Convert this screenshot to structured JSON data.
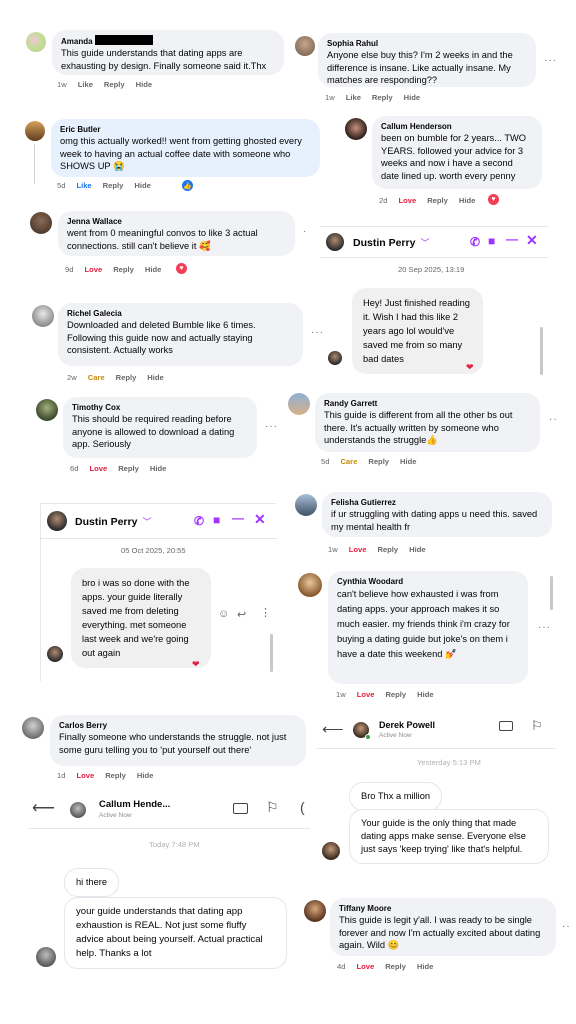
{
  "comments": {
    "amanda": {
      "name": "Amanda",
      "text": "This guide understands that dating apps are exhausting by design. Finally someone said it.Thx",
      "time": "1w",
      "like": "Like",
      "reply": "Reply",
      "hide": "Hide"
    },
    "sophia": {
      "name": "Sophia Rahul",
      "text": "Anyone else buy this? I'm 2 weeks in and the difference is insane. Like actually insane. My matches are responding??",
      "time": "1w",
      "like": "Like",
      "reply": "Reply",
      "hide": "Hide"
    },
    "eric": {
      "name": "Eric Butler",
      "text": "omg this actually worked!! went from getting ghosted every week to having an actual coffee date with someone who SHOWS UP 😭",
      "time": "5d",
      "like": "Like",
      "reply": "Reply",
      "hide": "Hide"
    },
    "callum": {
      "name": "Callum Henderson",
      "text": "been on bumble for 2 years... TWO YEARS. followed your advice for 3 weeks and now i have a second date lined up. worth every penny",
      "time": "2d",
      "love": "Love",
      "reply": "Reply",
      "hide": "Hide"
    },
    "jenna": {
      "name": "Jenna Wallace",
      "text": "went from 0 meaningful convos to like 3 actual connections. still can't believe it 🥰",
      "time": "9d",
      "love": "Love",
      "reply": "Reply",
      "hide": "Hide"
    },
    "richel": {
      "name": "Richel Galecia",
      "text": "Downloaded and deleted Bumble like 6 times. Following this guide now and actually staying consistent. Actually works",
      "time": "2w",
      "care": "Care",
      "reply": "Reply",
      "hide": "Hide"
    },
    "timothy": {
      "name": "Timothy Cox",
      "text": "This should be required reading before anyone is allowed to download a dating app. Seriously",
      "time": "6d",
      "love": "Love",
      "reply": "Reply",
      "hide": "Hide"
    },
    "randy": {
      "name": "Randy Garrett",
      "text": "This guide is different from all the other bs out there. It's actually written by someone who understands the struggle👍",
      "time": "5d",
      "care": "Care",
      "reply": "Reply",
      "hide": "Hide"
    },
    "felisha": {
      "name": "Felisha Gutierrez",
      "text": "if ur struggling with dating apps u need this. saved my mental health fr",
      "time": "1w",
      "love": "Love",
      "reply": "Reply",
      "hide": "Hide"
    },
    "cynthia": {
      "name": "Cynthia Woodard",
      "text": "can't believe how exhausted i was from dating apps. your approach makes it so much easier. my friends think i'm crazy for buying a dating guide but joke's on them i have a date this weekend 💅",
      "time": "1w",
      "love": "Love",
      "reply": "Reply",
      "hide": "Hide"
    },
    "carlos": {
      "name": "Carlos Berry",
      "text": "Finally someone who understands the struggle. not just some guru telling you to 'put yourself out there'",
      "time": "1d",
      "love": "Love",
      "reply": "Reply",
      "hide": "Hide"
    },
    "tiffany": {
      "name": "Tiffany Moore",
      "text": "This guide is legit y'all. I was ready to be single forever and now I'm actually excited about dating again. Wild 😊",
      "time": "4d",
      "love": "Love",
      "reply": "Reply",
      "hide": "Hide"
    }
  },
  "chat1": {
    "name": "Dustin Perry",
    "date": "20 Sep 2025, 13:19",
    "message": "Hey! Just finished reading it. Wish I had this like 2 years ago lol would've saved me from so many bad dates"
  },
  "chat2": {
    "name": "Dustin Perry",
    "date": "05 Oct 2025, 20:55",
    "message": "bro i was so done with the apps. your guide literally saved me from deleting everything. met someone last week and we're going out again"
  },
  "chat3": {
    "name": "Derek Powell",
    "status": "Active Now",
    "time": "Yesterday 5:13 PM",
    "msg1": "Bro Thx a million",
    "msg2": "Your guide is the only thing that made dating apps make sense. Everyone else just says 'keep trying' like that's helpful."
  },
  "chat4": {
    "name": "Callum Hende...",
    "status": "Active Now",
    "time": "Today 7:48 PM",
    "msg1": "hi there",
    "msg2": "your guide understands that dating app exhaustion is REAL. Not just some fluffy advice about being yourself. Actual practical help. Thanks a lot"
  },
  "colors": {
    "messenger_accent": "#a033ff",
    "like_blue": "#1877f2",
    "love_red": "#e41e3f",
    "care_gold": "#c98b0a",
    "bubble_grey": "#f0f2f5"
  }
}
